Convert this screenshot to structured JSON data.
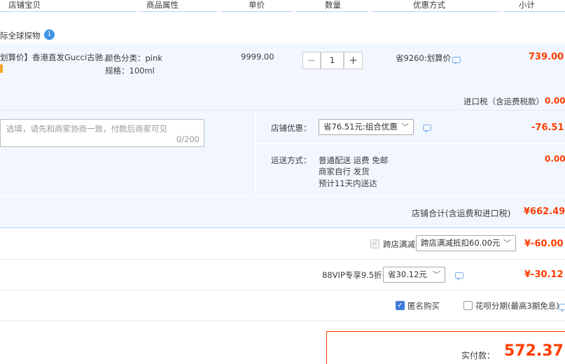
{
  "header": {
    "col_shop_item": "店铺宝贝",
    "col_attributes": "商品属性",
    "col_unit_price": "单价",
    "col_quantity": "数量",
    "col_discount": "优惠方式",
    "col_subtotal": "小计"
  },
  "shop": {
    "name": "际全球探物",
    "badge": "1"
  },
  "item": {
    "title": "划算价】香港直发Gucci古驰...",
    "color_label": "颜色分类：pink",
    "spec_label": "规格：100ml",
    "unit_price": "9999.00",
    "quantity": "1",
    "minus": "−",
    "plus": "+",
    "discount": "省9260:划算价",
    "subtotal": "739.00"
  },
  "import_tax": {
    "label": "进口税（含运费税款）",
    "value": "0.00"
  },
  "message": {
    "placeholder": "选填，请先和商家协商一致，付款后商家可见",
    "counter": "0/200"
  },
  "shop_discount": {
    "label": "店铺优惠：",
    "selected": "省76.51元:组合优惠",
    "value": "-76.51"
  },
  "shipping": {
    "label": "运送方式：",
    "line1": "普通配送 运费 免邮",
    "line2": "商家自行  发货",
    "line3": "预计11天内送达",
    "value": "0.00"
  },
  "shop_total": {
    "label": "店铺合计(含运费和进口税)",
    "value": "¥662.49"
  },
  "cross_store": {
    "label": "跨店满减",
    "selected": "跨店满减抵扣60.00元",
    "value": "¥-60.00"
  },
  "vip": {
    "label": "88VIP专享9.5折",
    "selected": "省30.12元",
    "value": "¥-30.12"
  },
  "options": {
    "anonymous": "匿名购买",
    "huabei": "花呗分期(最高3期免息)"
  },
  "payment": {
    "label": "实付款：",
    "amount": "572.37"
  },
  "colors": {
    "accent_red": "#ff3d00",
    "light_blue_bg": "#f2f7ff",
    "header_line": "#b2d1ff"
  }
}
